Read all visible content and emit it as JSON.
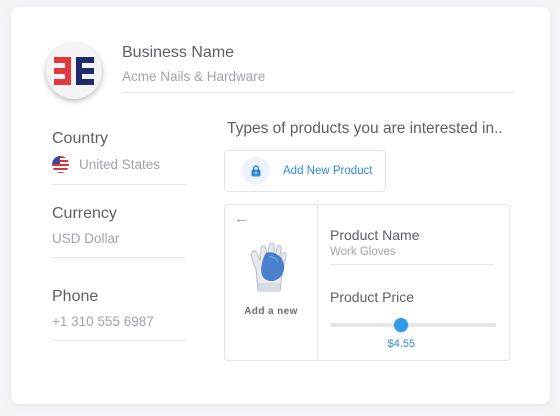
{
  "business": {
    "label": "Business Name",
    "value": "Acme Nails & Hardware"
  },
  "country": {
    "label": "Country",
    "value": "United States",
    "flag_icon": "us-flag-icon"
  },
  "currency": {
    "label": "Currency",
    "value": "USD Dollar"
  },
  "phone": {
    "label": "Phone",
    "value": "+1 310 555 6987"
  },
  "products": {
    "title": "Types of products you are interested in..",
    "add_button_label": "Add New Product",
    "add_button_icon": "lock-icon",
    "panel": {
      "back_icon": "back-arrow-icon",
      "image_icon": "work-glove-image",
      "add_new_label": "Add a new",
      "product_name_label": "Product Name",
      "product_name_value": "Work Gloves",
      "product_price_label": "Product Price",
      "price_value": "$4.55",
      "price_slider_level": 0.43
    }
  },
  "colors": {
    "accent": "#2e9be8",
    "link": "#2f8ae0"
  }
}
